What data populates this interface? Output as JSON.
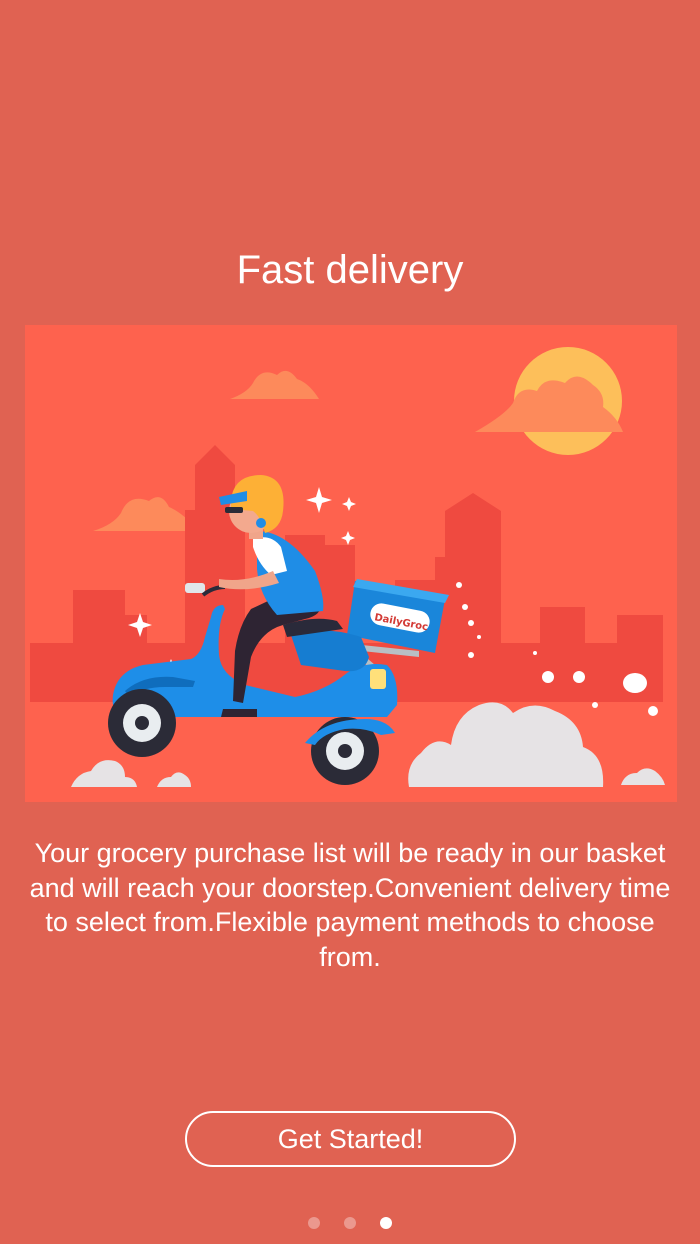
{
  "onboarding": {
    "title": "Fast delivery",
    "description": "Your grocery purchase list will be ready in our basket and will reach your doorstep.Convenient delivery time to select from.Flexible payment methods to choose from.",
    "illustration": {
      "brand_text": "DailyGroc",
      "icon": "delivery-scooter-illustration"
    },
    "cta_label": "Get Started!",
    "pager": {
      "total": 3,
      "active_index": 2
    }
  },
  "colors": {
    "background": "#e06252",
    "illustration_bg": "#fe624e",
    "button_border": "#ffffff",
    "scooter": "#1e8ee8",
    "sun": "#fdbf5a"
  }
}
